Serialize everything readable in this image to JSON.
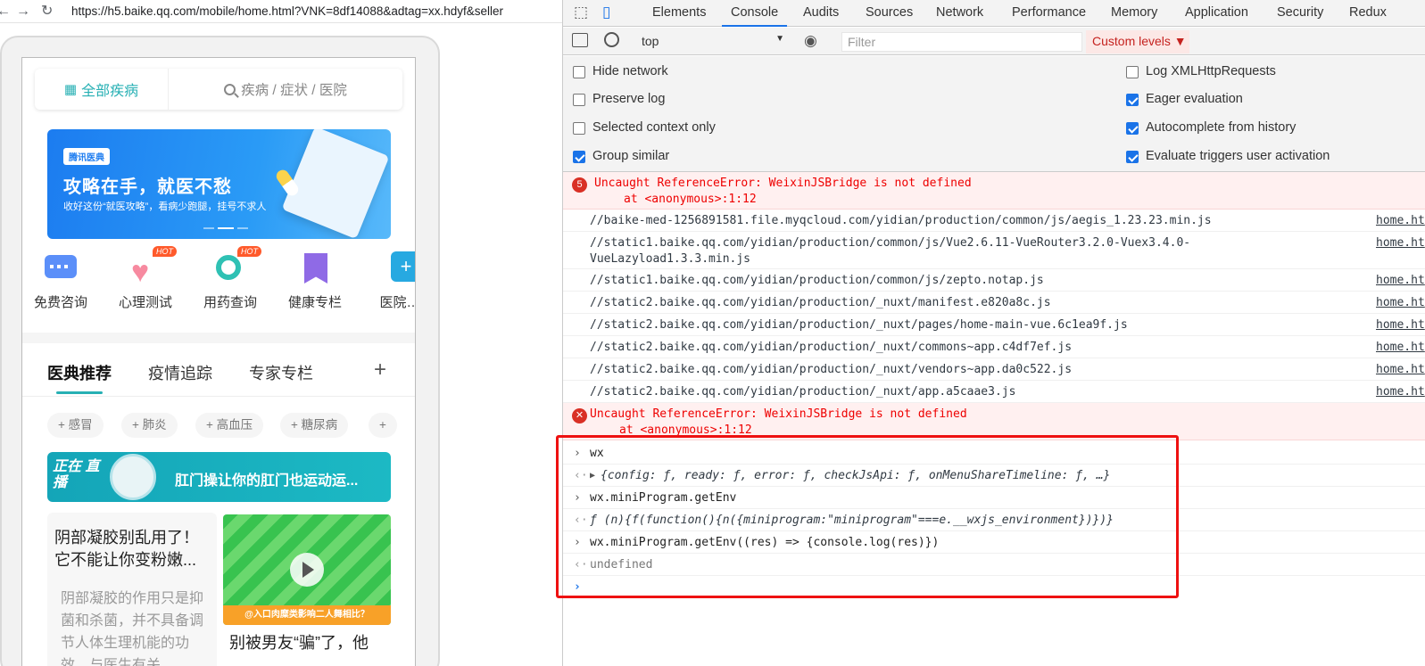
{
  "browser": {
    "url": "https://h5.baike.qq.com/mobile/home.html?VNK=8df14088&adtag=xx.hdyf&seller"
  },
  "mobile": {
    "top": {
      "all_label": "全部疾病",
      "search_placeholder": "疾病 / 症状 / 医院"
    },
    "banner": {
      "logo": "腾讯医典",
      "headline": "攻略在手，就医不愁",
      "sub": "收好这份“就医攻略”，看病少跑腿，挂号不求人"
    },
    "icons": [
      {
        "label": "免费咨询"
      },
      {
        "label": "心理测试",
        "badge": "HOT"
      },
      {
        "label": "用药查询",
        "badge": "HOT"
      },
      {
        "label": "健康专栏"
      },
      {
        "label": "医院…"
      }
    ],
    "tabs": [
      "医典推荐",
      "疫情追踪",
      "专家专栏"
    ],
    "plus": "+",
    "chips": [
      "+ 感冒",
      "+ 肺炎",
      "+ 高血压",
      "+ 糖尿病",
      "+"
    ],
    "live": {
      "tag": "正在 直播",
      "title": "肛门操让你的肛门也运动运..."
    },
    "article1": {
      "title": "阴部凝胶别乱用了！它不能让你变粉嫩...",
      "body": "阴部凝胶的作用只是抑菌和杀菌，并不具备调节人体生理机能的功效，与医生有关"
    },
    "video_caption": "@入口肉糜类影响二人舞相比？",
    "article2": {
      "title": "别被男友“骗”了，他"
    }
  },
  "devtools": {
    "tabs": [
      "Elements",
      "Console",
      "Audits",
      "Sources",
      "Network",
      "Performance",
      "Memory",
      "Application",
      "Security",
      "Redux"
    ],
    "active_tab": "Console",
    "context": "top",
    "filter_placeholder": "Filter",
    "levels": "Custom levels ▼",
    "options_left": [
      {
        "label": "Hide network",
        "checked": false
      },
      {
        "label": "Preserve log",
        "checked": false
      },
      {
        "label": "Selected context only",
        "checked": false
      },
      {
        "label": "Group similar",
        "checked": true
      }
    ],
    "options_right": [
      {
        "label": "Log XMLHttpRequests",
        "checked": false
      },
      {
        "label": "Eager evaluation",
        "checked": true
      },
      {
        "label": "Autocomplete from history",
        "checked": true
      },
      {
        "label": "Evaluate triggers user activation",
        "checked": true
      }
    ],
    "error1": {
      "count": "5",
      "message": "Uncaught ReferenceError: WeixinJSBridge is not defined",
      "stack": "at <anonymous>:1:12"
    },
    "scripts": [
      {
        "path": "//baike-med-1256891581.file.myqcloud.com/yidian/production/common/js/aegis_1.23.23.min.js",
        "source": "home.ht"
      },
      {
        "path": "//static1.baike.qq.com/yidian/production/common/js/Vue2.6.11-VueRouter3.2.0-Vuex3.4.0-\nVueLazyload1.3.3.min.js",
        "source": "home.ht"
      },
      {
        "path": "//static1.baike.qq.com/yidian/production/common/js/zepto.notap.js",
        "source": "home.ht"
      },
      {
        "path": "//static2.baike.qq.com/yidian/production/_nuxt/manifest.e820a8c.js",
        "source": "home.ht"
      },
      {
        "path": "//static2.baike.qq.com/yidian/production/_nuxt/pages/home-main-vue.6c1ea9f.js",
        "source": "home.ht"
      },
      {
        "path": "//static2.baike.qq.com/yidian/production/_nuxt/commons~app.c4df7ef.js",
        "source": "home.ht"
      },
      {
        "path": "//static2.baike.qq.com/yidian/production/_nuxt/vendors~app.da0c522.js",
        "source": "home.ht"
      },
      {
        "path": "//static2.baike.qq.com/yidian/production/_nuxt/app.a5caae3.js",
        "source": "home.ht"
      }
    ],
    "error2": {
      "message": "Uncaught ReferenceError: WeixinJSBridge is not defined",
      "stack": "at <anonymous>:1:12"
    },
    "commands": [
      {
        "input": "wx",
        "output": "{config: ƒ, ready: ƒ, error: ƒ, checkJsApi: ƒ, onMenuShareTimeline: ƒ, …}"
      },
      {
        "input": "wx.miniProgram.getEnv",
        "output": "ƒ (n){f(function(){n({miniprogram:\"miniprogram\"===e.__wxjs_environment})})}"
      },
      {
        "input": "wx.miniProgram.getEnv((res) => {console.log(res)})",
        "output": "undefined"
      }
    ],
    "highlight_color": "#ee1111"
  }
}
